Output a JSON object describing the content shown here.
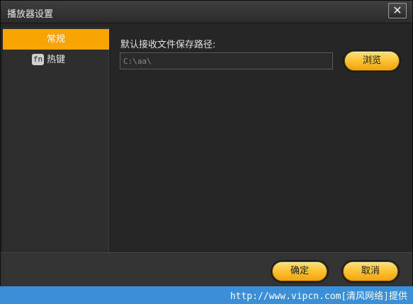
{
  "window": {
    "title": "播放器设置",
    "close_glyph": "✕"
  },
  "sidebar": {
    "items": [
      {
        "label": "常规",
        "active": true
      },
      {
        "label": "热键",
        "icon": "fn-key-icon",
        "icon_text": "fn",
        "active": false
      }
    ]
  },
  "general": {
    "path_label": "默认接收文件保存路径:",
    "path_value": "C:\\aa\\",
    "browse_label": "浏览"
  },
  "footer": {
    "ok_label": "确定",
    "cancel_label": "取消"
  },
  "watermark": {
    "text": "http://www.vipcn.com[清风网络]提供"
  },
  "colors": {
    "accent": "#f8a402",
    "background": "#262626",
    "watermark_bar": "#3a8fd6"
  }
}
